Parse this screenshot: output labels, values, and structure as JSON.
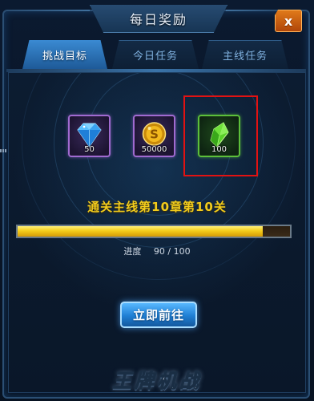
{
  "dialog": {
    "title": "每日奖励",
    "close_label": "x"
  },
  "tabs": [
    {
      "label": "挑战目标",
      "active": true
    },
    {
      "label": "今日任务",
      "active": false
    },
    {
      "label": "主线任务",
      "active": false
    }
  ],
  "rewards": [
    {
      "icon": "blue-diamond-icon",
      "quantity": "50",
      "rarity_color": "#a06ad0"
    },
    {
      "icon": "gold-coin-icon",
      "quantity": "50000",
      "rarity_color": "#a06ad0"
    },
    {
      "icon": "green-crystal-icon",
      "quantity": "100",
      "rarity_color": "#5cbf3a",
      "highlighted": true
    }
  ],
  "mission": {
    "description": "通关主线第10章第10关"
  },
  "progress": {
    "label": "进度",
    "text": "90 / 100",
    "current": 90,
    "total": 100
  },
  "action": {
    "go_label": "立即前往"
  },
  "logo": {
    "text": "王牌机战"
  },
  "colors": {
    "accent_gold": "#f2cc1c",
    "button_blue": "#1f7fd4",
    "close_orange": "#e07a1a",
    "highlight_red": "#e21212"
  }
}
